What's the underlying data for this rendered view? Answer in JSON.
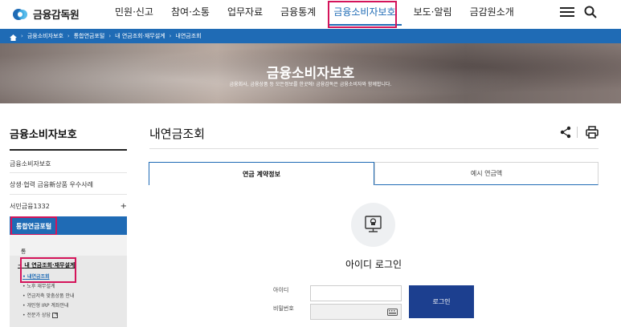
{
  "header": {
    "logo_text": "금융감독원",
    "nav": [
      "민원·신고",
      "참여·소통",
      "업무자료",
      "금융통계",
      "금융소비자보호",
      "보도·알림",
      "금감원소개"
    ],
    "active_nav_index": 4,
    "menu_icon": "hamburger-menu-icon",
    "search_icon": "search-icon"
  },
  "breadcrumb": {
    "home_icon": "home-icon",
    "items": [
      "금융소비자보호",
      "통합연금포털",
      "내 연금조회·재무설계",
      "내연금조회"
    ]
  },
  "hero": {
    "title": "금융소비자보호",
    "subtitle": "금융회사, 금융상품 등 모든정보를 한곳에! 금융감독은 금융소비자와 함께합니다."
  },
  "sidebar": {
    "title": "금융소비자보호",
    "items": [
      "금융소비자보호",
      "상생·협력 금융新상품 우수사례",
      "서민금융1332"
    ],
    "expand_symbol": "+",
    "active_item": "통합연금포털",
    "sub_item": "통합연금포털",
    "sub_group": "내 연금조회·재무설계",
    "sub_links": [
      "내연금조회",
      "노후 재무설계",
      "연금저축 맞춤상품 안내",
      "개인형 IRP 계좌안내",
      "전문가 상담"
    ],
    "bullet": "•",
    "sub_dash": "−",
    "active_sub_link_index": 0
  },
  "main": {
    "title": "내연금조회",
    "share_icon": "share-icon",
    "print_icon": "print-icon",
    "tabs": [
      "연금 계약정보",
      "예시 연금액"
    ],
    "active_tab_index": 0,
    "login_title": "아이디 로그인",
    "id_label": "아이디",
    "pw_label": "비밀번호",
    "login_button": "로그인",
    "keyboard_icon": "keyboard-icon",
    "certificate_icon": "certificate-icon"
  },
  "colors": {
    "brand_blue": "#1f6bb5",
    "button_navy": "#1c3f8f",
    "highlight_pink": "#d4145a"
  }
}
